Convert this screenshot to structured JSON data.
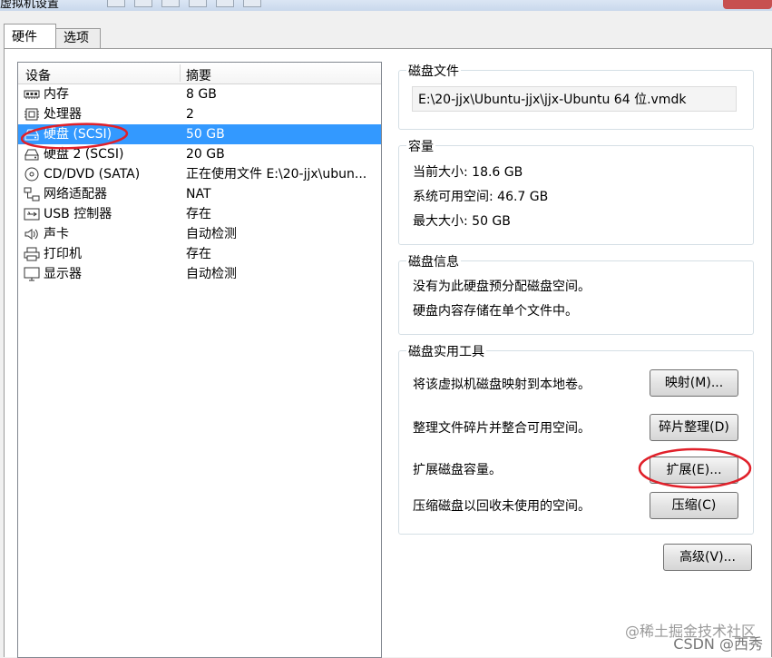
{
  "window": {
    "title": "虚拟机设置"
  },
  "tabs": [
    {
      "label": "硬件",
      "active": true
    },
    {
      "label": "选项",
      "active": false
    }
  ],
  "devices": {
    "columns": [
      "设备",
      "摘要"
    ],
    "rows": [
      {
        "icon": "memory-icon",
        "name": "内存",
        "summary": "8 GB",
        "selected": false
      },
      {
        "icon": "processor-icon",
        "name": "处理器",
        "summary": "2",
        "selected": false
      },
      {
        "icon": "harddisk-icon",
        "name": "硬盘 (SCSI)",
        "summary": "50 GB",
        "selected": true
      },
      {
        "icon": "harddisk-icon",
        "name": "硬盘 2 (SCSI)",
        "summary": "20 GB",
        "selected": false
      },
      {
        "icon": "cd-dvd-icon",
        "name": "CD/DVD (SATA)",
        "summary": "正在使用文件 E:\\20-jjx\\ubun...",
        "selected": false
      },
      {
        "icon": "network-icon",
        "name": "网络适配器",
        "summary": "NAT",
        "selected": false
      },
      {
        "icon": "usb-icon",
        "name": "USB 控制器",
        "summary": "存在",
        "selected": false
      },
      {
        "icon": "sound-icon",
        "name": "声卡",
        "summary": "自动检测",
        "selected": false
      },
      {
        "icon": "printer-icon",
        "name": "打印机",
        "summary": "存在",
        "selected": false
      },
      {
        "icon": "display-icon",
        "name": "显示器",
        "summary": "自动检测",
        "selected": false
      }
    ]
  },
  "disk_file": {
    "legend": "磁盘文件",
    "path": "E:\\20-jjx\\Ubuntu-jjx\\jjx-Ubuntu 64 位.vmdk"
  },
  "capacity": {
    "legend": "容量",
    "current_size": "当前大小: 18.6 GB",
    "available": "系统可用空间: 46.7 GB",
    "max_size": "最大大小: 50 GB"
  },
  "disk_info": {
    "legend": "磁盘信息",
    "line1": "没有为此硬盘预分配磁盘空间。",
    "line2": "硬盘内容存储在单个文件中。"
  },
  "disk_tools": {
    "legend": "磁盘实用工具",
    "map_desc": "将该虚拟机磁盘映射到本地卷。",
    "map_button": "映射(M)...",
    "defrag_desc": "整理文件碎片并整合可用空间。",
    "defrag_button": "碎片整理(D)",
    "expand_desc": "扩展磁盘容量。",
    "expand_button": "扩展(E)...",
    "compact_desc": "压缩磁盘以回收未使用的空间。",
    "compact_button": "压缩(C)"
  },
  "advanced_button": "高级(V)...",
  "watermark": {
    "line1": "@稀土掘金技术社区",
    "line2": "CSDN @西秀"
  },
  "colors": {
    "selection": "#3399ff",
    "annotation": "#e0202a"
  }
}
